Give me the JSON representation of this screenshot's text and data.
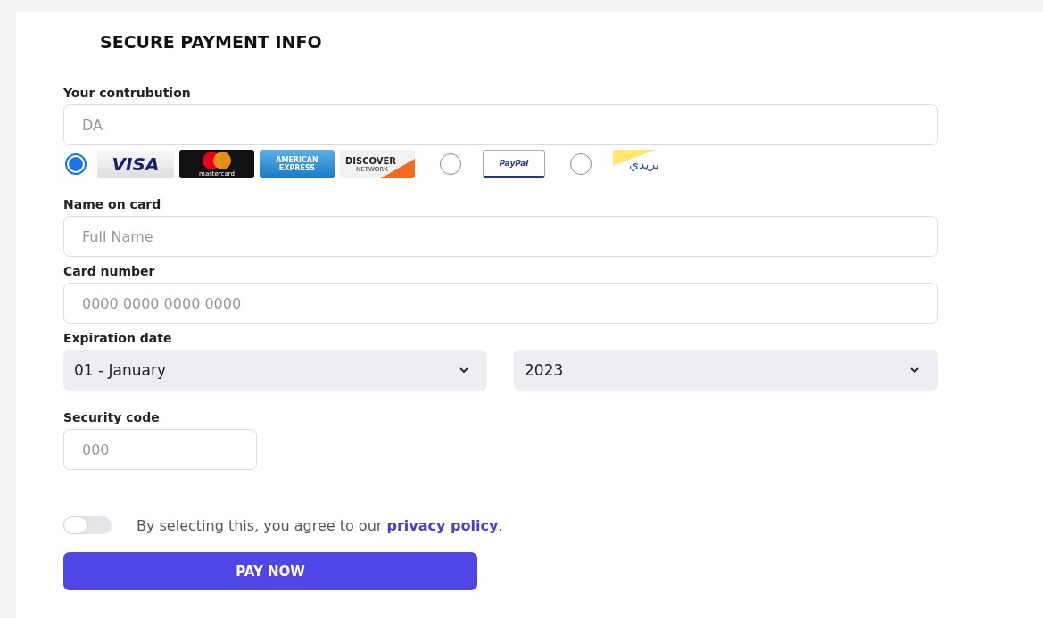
{
  "title": "SECURE PAYMENT INFO",
  "contribution": {
    "label": "Your contrubution",
    "placeholder": "DA"
  },
  "payment_methods": [
    {
      "selected": true,
      "logos": [
        {
          "kind": "visa",
          "text": "VISA"
        },
        {
          "kind": "mastercard",
          "text": "mastercard"
        },
        {
          "kind": "amex",
          "text": "AMERICAN",
          "sub": "EXPRESS"
        },
        {
          "kind": "discover",
          "text": "DISCOVER",
          "sub": "NETWORK"
        }
      ]
    },
    {
      "selected": false,
      "logos": [
        {
          "kind": "paypal",
          "text": "PayPal"
        }
      ]
    },
    {
      "selected": false,
      "logos": [
        {
          "kind": "baridi",
          "text": "بريدي"
        }
      ]
    }
  ],
  "name_on_card": {
    "label": "Name on card",
    "placeholder": "Full Name"
  },
  "card_number": {
    "label": "Card number",
    "placeholder": "0000 0000 0000 0000"
  },
  "expiration": {
    "label": "Expiration date",
    "month": "01 - January",
    "year": "2023"
  },
  "security_code": {
    "label": "Security code",
    "placeholder": "000"
  },
  "agreement": {
    "on": false,
    "text": "By selecting this, you agree to our ",
    "link": "privacy policy",
    "end": "."
  },
  "pay_button": "PAY NOW"
}
